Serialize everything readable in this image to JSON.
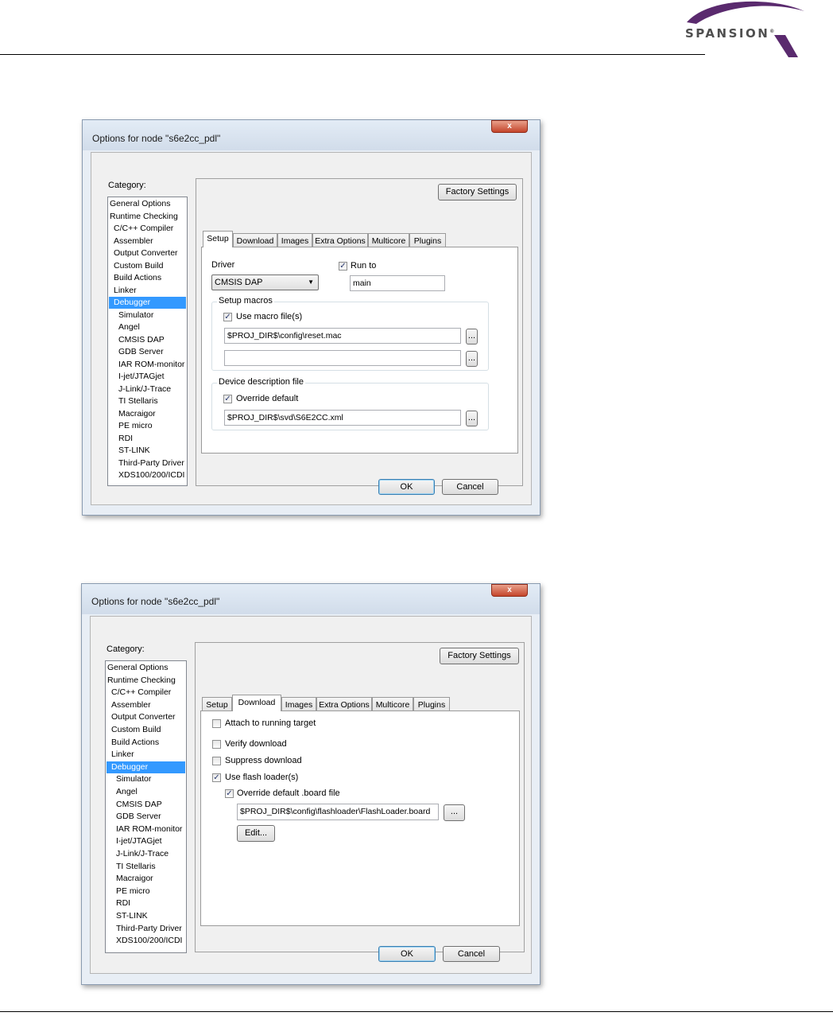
{
  "brand": {
    "name": "SPANSION",
    "mark": "®"
  },
  "dialog1": {
    "title": "Options for node \"s6e2cc_pdl\"",
    "close": "x",
    "category_label": "Category:",
    "categories": [
      "General Options",
      "Runtime Checking",
      "C/C++ Compiler",
      "Assembler",
      "Output Converter",
      "Custom Build",
      "Build Actions",
      "Linker",
      "Debugger",
      "Simulator",
      "Angel",
      "CMSIS DAP",
      "GDB Server",
      "IAR ROM-monitor",
      "I-jet/JTAGjet",
      "J-Link/J-Trace",
      "TI Stellaris",
      "Macraigor",
      "PE micro",
      "RDI",
      "ST-LINK",
      "Third-Party Driver",
      "XDS100/200/ICDI"
    ],
    "selected_category": "Debugger",
    "factory_settings": "Factory Settings",
    "tabs": [
      "Setup",
      "Download",
      "Images",
      "Extra Options",
      "Multicore",
      "Plugins"
    ],
    "active_tab": "Setup",
    "driver_label": "Driver",
    "driver_value": "CMSIS DAP",
    "run_to_label": "Run to",
    "run_to_checked": true,
    "run_to_value": "main",
    "setup_macros_label": "Setup macros",
    "use_macro_label": "Use macro file(s)",
    "use_macro_checked": true,
    "macro_file_1": "$PROJ_DIR$\\config\\reset.mac",
    "macro_file_2": "",
    "browse": "...",
    "device_desc_label": "Device description file",
    "override_label": "Override default",
    "override_checked": true,
    "device_file": "$PROJ_DIR$\\svd\\S6E2CC.xml",
    "ok": "OK",
    "cancel": "Cancel"
  },
  "dialog2": {
    "title": "Options for node \"s6e2cc_pdl\"",
    "close": "x",
    "category_label": "Category:",
    "categories": [
      "General Options",
      "Runtime Checking",
      "C/C++ Compiler",
      "Assembler",
      "Output Converter",
      "Custom Build",
      "Build Actions",
      "Linker",
      "Debugger",
      "Simulator",
      "Angel",
      "CMSIS DAP",
      "GDB Server",
      "IAR ROM-monitor",
      "I-jet/JTAGjet",
      "J-Link/J-Trace",
      "TI Stellaris",
      "Macraigor",
      "PE micro",
      "RDI",
      "ST-LINK",
      "Third-Party Driver",
      "XDS100/200/ICDI"
    ],
    "selected_category": "Debugger",
    "factory_settings": "Factory Settings",
    "tabs": [
      "Setup",
      "Download",
      "Images",
      "Extra Options",
      "Multicore",
      "Plugins"
    ],
    "active_tab": "Download",
    "attach_label": "Attach to running target",
    "attach_checked": false,
    "verify_label": "Verify download",
    "verify_checked": false,
    "suppress_label": "Suppress download",
    "suppress_checked": false,
    "flash_loader_label": "Use flash loader(s)",
    "flash_loader_checked": true,
    "override_board_label": "Override default .board file",
    "override_board_checked": true,
    "board_file": "$PROJ_DIR$\\config\\flashloader\\FlashLoader.board",
    "browse": "...",
    "edit": "Edit...",
    "ok": "OK",
    "cancel": "Cancel"
  }
}
